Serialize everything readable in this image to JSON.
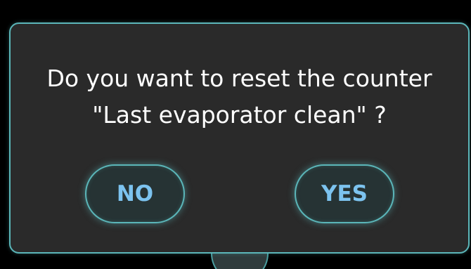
{
  "dialog": {
    "message_line1": "Do you want to reset the counter",
    "message_line2": "\"Last evaporator clean\" ?",
    "no_label": "NO",
    "yes_label": "YES"
  },
  "colors": {
    "background": "#000000",
    "dialog_fill": "#2a2a2a",
    "accent_border": "#5bb6b9",
    "button_text": "#7cc3ef",
    "message_text": "#ffffff"
  }
}
